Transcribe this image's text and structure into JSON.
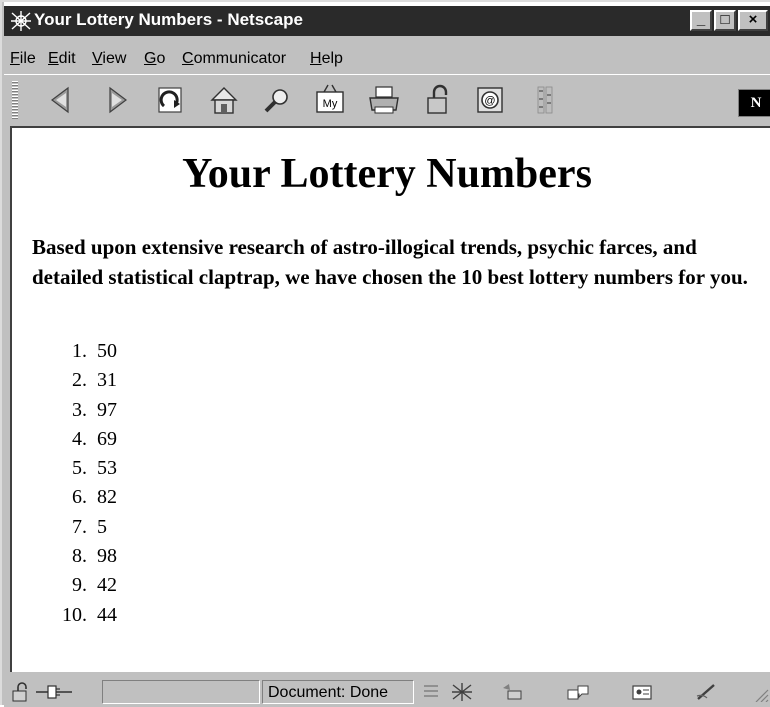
{
  "window": {
    "title": "Your Lottery Numbers - Netscape",
    "controls": [
      "_",
      "□",
      "×"
    ]
  },
  "menu": {
    "items": [
      {
        "accel": "F",
        "rest": "ile"
      },
      {
        "accel": "E",
        "rest": "dit"
      },
      {
        "accel": "V",
        "rest": "iew"
      },
      {
        "accel": "G",
        "rest": "o"
      },
      {
        "accel": "C",
        "rest": "ommunicator"
      },
      {
        "accel": "H",
        "rest": "elp"
      }
    ]
  },
  "toolbar": {
    "icons": [
      "back-icon",
      "forward-icon",
      "reload-icon",
      "home-icon",
      "search-icon",
      "my-netscape-icon",
      "print-icon",
      "security-icon",
      "shop-icon",
      "stop-icon"
    ],
    "logo_text": "N"
  },
  "page": {
    "title": "Your Lottery Numbers",
    "intro": "Based upon extensive research of astro-illogical trends, psychic farces, and detailed statistical claptrap, we have chosen the 10 best lottery numbers for you.",
    "numbers": [
      {
        "index": "1.",
        "value": "50"
      },
      {
        "index": "2.",
        "value": "31"
      },
      {
        "index": "3.",
        "value": "97"
      },
      {
        "index": "4.",
        "value": "69"
      },
      {
        "index": "5.",
        "value": "53"
      },
      {
        "index": "6.",
        "value": "82"
      },
      {
        "index": "7.",
        "value": "5"
      },
      {
        "index": "8.",
        "value": "98"
      },
      {
        "index": "9.",
        "value": "42"
      },
      {
        "index": "10.",
        "value": "44"
      }
    ]
  },
  "status": {
    "text": "Document: Done"
  },
  "colors": {
    "titlebar": "#2a2a2a",
    "chrome": "#c0c0c0",
    "content_bg": "#ffffff"
  }
}
